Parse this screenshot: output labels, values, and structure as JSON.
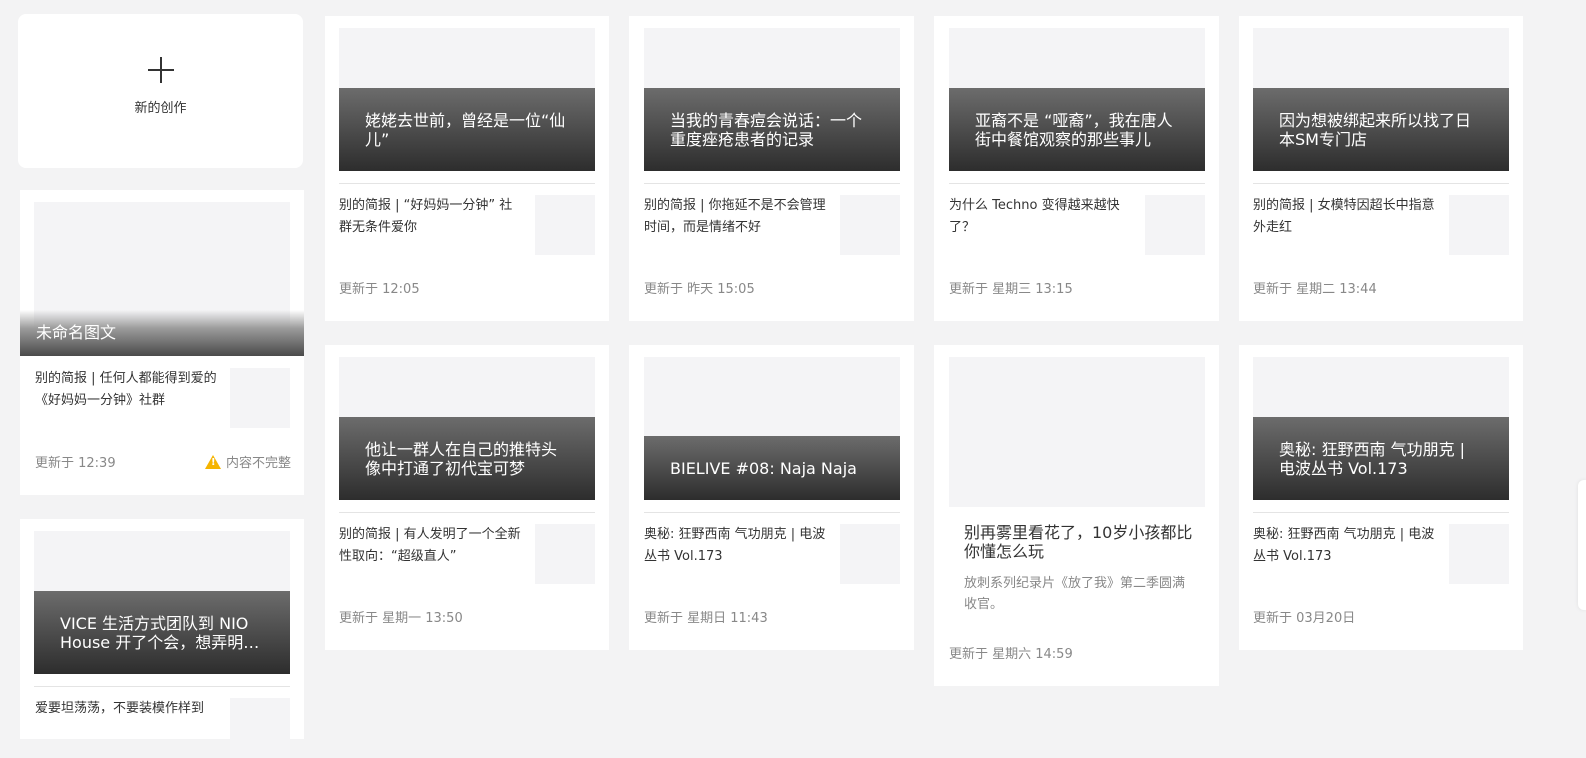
{
  "new_card": {
    "label": "新的创作"
  },
  "drafts": [
    {
      "title": "未命名图文",
      "summary": "别的简报 | 任何人都能得到爱的《好妈妈一分钟》社群",
      "updated": "更新于 12:39",
      "warning": "内容不完整"
    },
    {
      "title": "VICE 生活方式团队到 NIO House 开了个会，想弄明…",
      "summary": "爱要坦荡荡，不要装模作样到"
    }
  ],
  "articles": [
    {
      "title": "姥姥去世前，曾经是一位“仙儿”",
      "summary": "别的简报 | “好妈妈一分钟” 社群无条件爱你",
      "updated": "更新于 12:05"
    },
    {
      "title": "当我的青春痘会说话：一个重度痤疮患者的记录",
      "summary": "别的简报 | 你拖延不是不会管理时间，而是情绪不好",
      "updated": "更新于 昨天 15:05"
    },
    {
      "title": "亚裔不是 “哑裔”，我在唐人街中餐馆观察的那些事儿",
      "summary": "为什么 Techno 变得越来越快了？",
      "updated": "更新于 星期三 13:15"
    },
    {
      "title": "因为想被绑起来所以找了日本SM专门店",
      "summary": "别的简报 | 女模特因超长中指意外走红",
      "updated": "更新于 星期二 13:44"
    },
    {
      "title": "他让一群人在自己的推特头像中打通了初代宝可梦",
      "summary": "别的简报 | 有人发明了一个全新性取向：“超级直人”",
      "updated": "更新于 星期一 13:50"
    },
    {
      "title": "BIELIVE #08: Naja Naja",
      "summary": "奥秘: 狂野西南 气功朋克 | 电波丛书 Vol.173",
      "updated": "更新于 星期日 11:43"
    },
    {
      "title": "别再雾里看花了，10岁小孩都比你懂怎么玩",
      "desc": "放刺系列纪录片《放了我》第二季圆满收官。",
      "updated": "更新于 星期六 14:59"
    },
    {
      "title": "奥秘: 狂野西南 气功朋克 | 电波丛书 Vol.173",
      "summary": "奥秘: 狂野西南 气功朋克 | 电波丛书 Vol.173",
      "updated": "更新于 03月20日"
    }
  ]
}
